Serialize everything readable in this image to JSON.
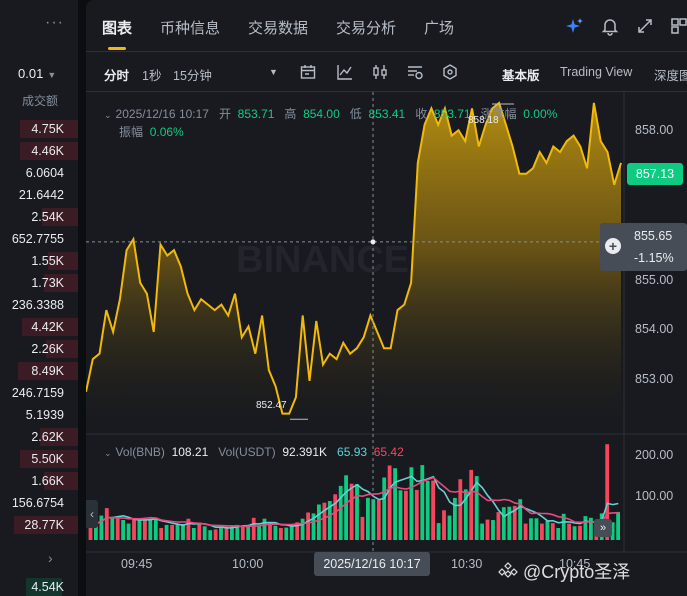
{
  "order_book": {
    "menu_icon": "more-dots-icon",
    "precision": "0.01",
    "column_header": "成交额",
    "rows": [
      {
        "value": "4.75K",
        "side": "sell"
      },
      {
        "value": "4.46K",
        "side": "sell"
      },
      {
        "value": "6.0604",
        "side": "none"
      },
      {
        "value": "21.6442",
        "side": "none"
      },
      {
        "value": "2.54K",
        "side": "sell"
      },
      {
        "value": "652.7755",
        "side": "none"
      },
      {
        "value": "1.55K",
        "side": "sell"
      },
      {
        "value": "1.73K",
        "side": "sell"
      },
      {
        "value": "236.3388",
        "side": "none"
      },
      {
        "value": "4.42K",
        "side": "sell"
      },
      {
        "value": "2.26K",
        "side": "sell"
      },
      {
        "value": "8.49K",
        "side": "sell"
      },
      {
        "value": "246.7159",
        "side": "none"
      },
      {
        "value": "5.1939",
        "side": "none"
      },
      {
        "value": "2.62K",
        "side": "sell"
      },
      {
        "value": "5.50K",
        "side": "sell"
      },
      {
        "value": "1.66K",
        "side": "sell"
      },
      {
        "value": "156.6754",
        "side": "none"
      },
      {
        "value": "28.77K",
        "side": "sell"
      }
    ],
    "next_icon": "chevron-right-icon",
    "last_value": "4.54K"
  },
  "tabs": [
    "图表",
    "币种信息",
    "交易数据",
    "交易分析",
    "广场"
  ],
  "toolbar": {
    "intervals": [
      "分时",
      "1秒",
      "15分钟"
    ],
    "views": [
      "基本版",
      "Trading View",
      "深度图"
    ]
  },
  "info": {
    "datetime": "2025/12/16 10:17",
    "open_label": "开",
    "open": "853.71",
    "high_label": "高",
    "high": "854.00",
    "low_label": "低",
    "low": "853.41",
    "close_label": "收",
    "close": "853.71",
    "change_label": "涨跌幅",
    "change": "0.00%",
    "amplitude_label": "振幅",
    "amplitude": "0.06%"
  },
  "vol_info": {
    "label1": "Vol(BNB)",
    "value1": "108.21",
    "label2": "Vol(USDT)",
    "value2": "92.391K",
    "ma1": "65.93",
    "ma2": "65.42"
  },
  "price_axis": [
    "858.00",
    "855.00",
    "854.00",
    "853.00"
  ],
  "vol_axis": [
    "200.00",
    "100.00"
  ],
  "time_axis": [
    "09:45",
    "10:00",
    "10:30",
    "10:45"
  ],
  "current_price": "857.13",
  "crosshair": {
    "price": "855.65",
    "pct": "-1.15%",
    "time": "2025/12/16 10:17"
  },
  "annotations": {
    "high": "858.18",
    "low": "852.47"
  },
  "watermark": {
    "text": "BINANCE"
  },
  "footer_credit": "@Crypto圣泽",
  "colors": {
    "line": "#f0b90b",
    "up": "#0ecb81",
    "down": "#f6465d",
    "ma1": "#62d1d4",
    "ma2": "#e8487f"
  },
  "chart_data": {
    "type": "area",
    "price_series": [
      852.9,
      853.5,
      853.6,
      854.4,
      854.0,
      854.6,
      855.5,
      855.7,
      854.9,
      854.7,
      854.0,
      855.6,
      855.4,
      855.5,
      855.2,
      854.7,
      854.4,
      854.6,
      854.5,
      854.4,
      854.5,
      854.3,
      854.7,
      853.9,
      854.1,
      853.6,
      854.3,
      853.3,
      853.0,
      852.5,
      852.5,
      852.8,
      854.3,
      853.1,
      854.2,
      853.4,
      853.6,
      853.5,
      853.8,
      853.6,
      853.7,
      853.9,
      854.3,
      854.0,
      853.7,
      853.7,
      854.4,
      854.5,
      854.9,
      857.1,
      857.8,
      858.1,
      857.8,
      858.1,
      857.6,
      857.7,
      857.5,
      858.1,
      857.4,
      857.8,
      858.1,
      858.2,
      857.8,
      857.4,
      856.9,
      856.9,
      857.0,
      857.3,
      857.1,
      857.4,
      857.3,
      857.5,
      857.6,
      857.4,
      857.0,
      858.2,
      857.5,
      857.3,
      856.7,
      857.1
    ],
    "volume_series": [
      38,
      35,
      55,
      72,
      52,
      49,
      45,
      37,
      49,
      47,
      48,
      48,
      48,
      27,
      34,
      34,
      35,
      36,
      48,
      27,
      39,
      31,
      22,
      24,
      29,
      30,
      33,
      34,
      33,
      33,
      50,
      31,
      48,
      34,
      32,
      27,
      28,
      35,
      40,
      48,
      62,
      60,
      80,
      84,
      88,
      103,
      122,
      146,
      127,
      126,
      52,
      95,
      92,
      90,
      141,
      168,
      162,
      112,
      111,
      164,
      113,
      169,
      133,
      134,
      38,
      67,
      55,
      95,
      137,
      114,
      158,
      144,
      37,
      46,
      45,
      63,
      74,
      75,
      77,
      92,
      37,
      49,
      49,
      37,
      43,
      38,
      27,
      59,
      37,
      31,
      32,
      54,
      50,
      33,
      60,
      216,
      40,
      63
    ],
    "volume_colors": "alternating up/down per candle",
    "ylim": [
      852.2,
      858.4
    ],
    "vol_ylim": [
      0,
      230
    ]
  }
}
